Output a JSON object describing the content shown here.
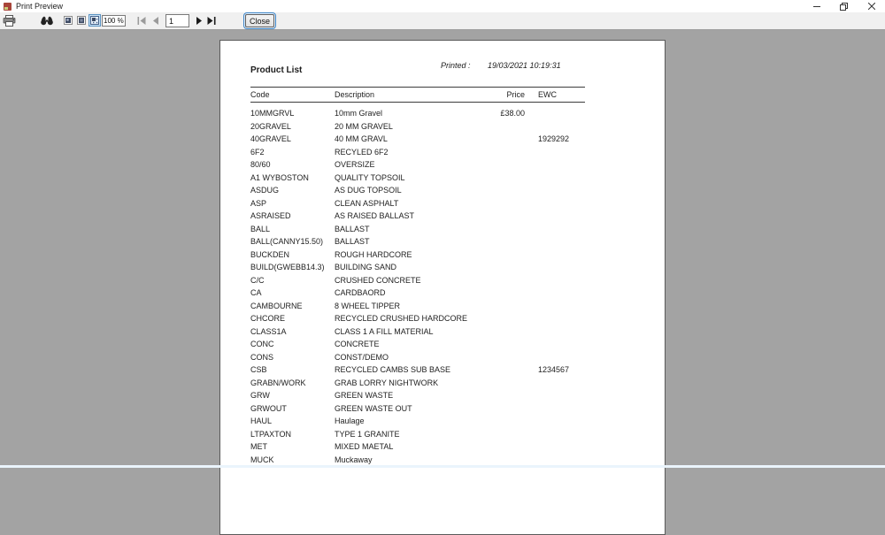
{
  "window": {
    "title": "Print Preview"
  },
  "toolbar": {
    "zoom_value": "100 %",
    "page_number": "1",
    "close_label": "Close"
  },
  "report": {
    "title": "Product List",
    "printed_label": "Printed :",
    "printed_value": "19/03/2021 10:19:31",
    "columns": [
      "Code",
      "Description",
      "Price",
      "EWC"
    ],
    "rows": [
      {
        "code": "10MMGRVL",
        "desc": "10mm Gravel",
        "price": "£38.00",
        "ewc": ""
      },
      {
        "code": "20GRAVEL",
        "desc": "20 MM GRAVEL",
        "price": "",
        "ewc": ""
      },
      {
        "code": "40GRAVEL",
        "desc": "40 MM GRAVL",
        "price": "",
        "ewc": "1929292"
      },
      {
        "code": "6F2",
        "desc": "RECYLED 6F2",
        "price": "",
        "ewc": ""
      },
      {
        "code": "80/60",
        "desc": "OVERSIZE",
        "price": "",
        "ewc": ""
      },
      {
        "code": "A1 WYBOSTON",
        "desc": "QUALITY TOPSOIL",
        "price": "",
        "ewc": ""
      },
      {
        "code": "ASDUG",
        "desc": "AS DUG TOPSOIL",
        "price": "",
        "ewc": ""
      },
      {
        "code": "ASP",
        "desc": "CLEAN ASPHALT",
        "price": "",
        "ewc": ""
      },
      {
        "code": "ASRAISED",
        "desc": "AS RAISED BALLAST",
        "price": "",
        "ewc": ""
      },
      {
        "code": "BALL",
        "desc": "BALLAST",
        "price": "",
        "ewc": ""
      },
      {
        "code": "BALL(CANNY15.50)",
        "desc": "BALLAST",
        "price": "",
        "ewc": ""
      },
      {
        "code": "BUCKDEN",
        "desc": "ROUGH HARDCORE",
        "price": "",
        "ewc": ""
      },
      {
        "code": "BUILD(GWEBB14.3)",
        "desc": "BUILDING SAND",
        "price": "",
        "ewc": ""
      },
      {
        "code": "C/C",
        "desc": "CRUSHED CONCRETE",
        "price": "",
        "ewc": ""
      },
      {
        "code": "CA",
        "desc": "CARDBAORD",
        "price": "",
        "ewc": ""
      },
      {
        "code": "CAMBOURNE",
        "desc": "8 WHEEL TIPPER",
        "price": "",
        "ewc": ""
      },
      {
        "code": "CHCORE",
        "desc": "RECYCLED CRUSHED HARDCORE",
        "price": "",
        "ewc": ""
      },
      {
        "code": "CLASS1A",
        "desc": "CLASS 1 A FILL MATERIAL",
        "price": "",
        "ewc": ""
      },
      {
        "code": "CONC",
        "desc": "CONCRETE",
        "price": "",
        "ewc": ""
      },
      {
        "code": "CONS",
        "desc": "CONST/DEMO",
        "price": "",
        "ewc": ""
      },
      {
        "code": "CSB",
        "desc": "RECYCLED CAMBS SUB BASE",
        "price": "",
        "ewc": "1234567"
      },
      {
        "code": "GRABN/WORK",
        "desc": "GRAB LORRY NIGHTWORK",
        "price": "",
        "ewc": ""
      },
      {
        "code": "GRW",
        "desc": "GREEN WASTE",
        "price": "",
        "ewc": ""
      },
      {
        "code": "GRWOUT",
        "desc": "GREEN WASTE OUT",
        "price": "",
        "ewc": ""
      },
      {
        "code": "HAUL",
        "desc": "Haulage",
        "price": "",
        "ewc": ""
      },
      {
        "code": "LTPAXTON",
        "desc": "TYPE 1 GRANITE",
        "price": "",
        "ewc": ""
      },
      {
        "code": "MET",
        "desc": "MIXED MAETAL",
        "price": "",
        "ewc": ""
      },
      {
        "code": "MUCK",
        "desc": "Muckaway",
        "price": "",
        "ewc": ""
      }
    ]
  }
}
